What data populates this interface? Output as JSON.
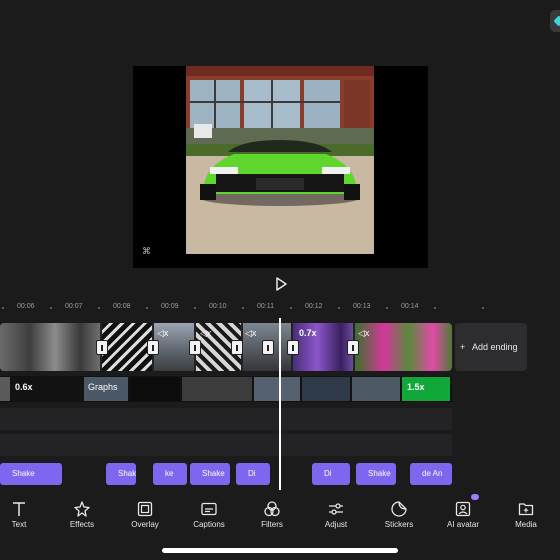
{
  "preview": {
    "watermark": "⌘",
    "play_label": "Play"
  },
  "timeline": {
    "ticks": [
      "00:06",
      "00:07",
      "00:08",
      "00:09",
      "00:10",
      "00:11",
      "00:12",
      "00:13",
      "00:14"
    ],
    "main_track": {
      "speed_badge": "0.7x",
      "add_ending": "Add ending"
    },
    "overlay_track": {
      "speed_left": "0.6x",
      "graphs_label": "Graphs",
      "speed_right": "1.5x"
    },
    "effects_track": {
      "clips": [
        "Shake",
        "Shake",
        "ke",
        "Shake",
        "Di",
        "Di",
        "Shake",
        "de An"
      ]
    }
  },
  "toolbar": {
    "items": [
      {
        "label": "Text",
        "icon": "text-icon"
      },
      {
        "label": "Effects",
        "icon": "effects-icon"
      },
      {
        "label": "Overlay",
        "icon": "overlay-icon"
      },
      {
        "label": "Captions",
        "icon": "captions-icon"
      },
      {
        "label": "Filters",
        "icon": "filters-icon"
      },
      {
        "label": "Adjust",
        "icon": "adjust-icon"
      },
      {
        "label": "Stickers",
        "icon": "stickers-icon"
      },
      {
        "label": "AI avatar",
        "icon": "ai-avatar-icon"
      },
      {
        "label": "Media",
        "icon": "media-icon"
      }
    ]
  },
  "colors": {
    "background": "#1b1b1c",
    "effect_clip": "#7f66ee",
    "speed_green": "#11a83a",
    "new_badge": "#a27cff",
    "accent_corner": "#3fd4d8"
  }
}
